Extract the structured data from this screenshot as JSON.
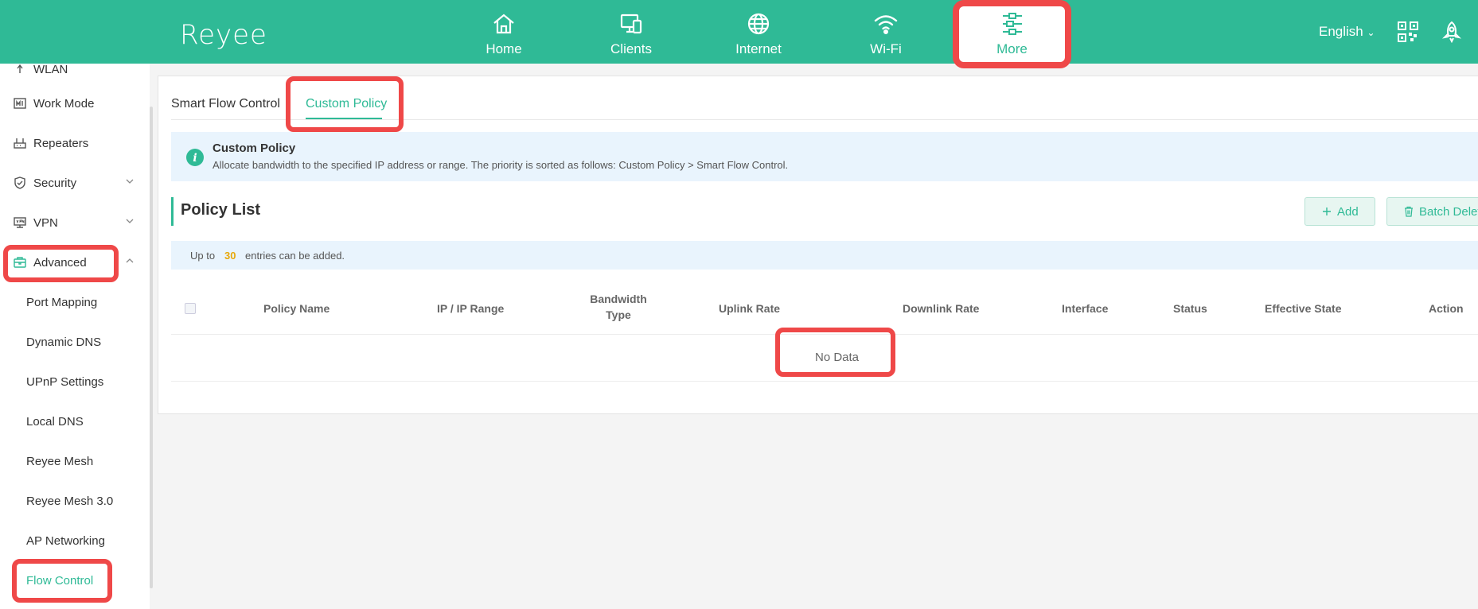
{
  "header": {
    "logo": "Reyee",
    "nav": [
      {
        "label": "Home",
        "icon": "home-icon"
      },
      {
        "label": "Clients",
        "icon": "devices-icon"
      },
      {
        "label": "Internet",
        "icon": "globe-icon"
      },
      {
        "label": "Wi-Fi",
        "icon": "wifi-icon"
      },
      {
        "label": "More",
        "icon": "sliders-icon",
        "active": true
      }
    ],
    "language": "English",
    "icons": [
      "qr-code-icon",
      "rocket-icon"
    ]
  },
  "sidebar": {
    "items": [
      {
        "label": "WLAN",
        "icon": "wlan-icon"
      },
      {
        "label": "Work Mode",
        "icon": "work-mode-icon"
      },
      {
        "label": "Repeaters",
        "icon": "router-icon"
      },
      {
        "label": "Security",
        "icon": "shield-icon",
        "expandable": true
      },
      {
        "label": "VPN",
        "icon": "vpn-icon",
        "expandable": true
      },
      {
        "label": "Advanced",
        "icon": "toolbox-icon",
        "expanded": true
      }
    ],
    "subitems": [
      "Port Mapping",
      "Dynamic DNS",
      "UPnP Settings",
      "Local DNS",
      "Reyee Mesh",
      "Reyee Mesh 3.0",
      "AP Networking",
      "Flow Control"
    ],
    "active_subitem": "Flow Control"
  },
  "main": {
    "tabs": [
      {
        "label": "Smart Flow Control"
      },
      {
        "label": "Custom Policy",
        "active": true
      }
    ],
    "info": {
      "title": "Custom Policy",
      "description": "Allocate bandwidth to the specified IP address or range. The priority is sorted as follows: Custom Policy > Smart Flow Control."
    },
    "policy_list": {
      "title": "Policy List",
      "add_label": "Add",
      "batch_delete_label": "Batch Delet",
      "limit_prefix": "Up to",
      "limit_count": "30",
      "limit_suffix": "entries can be added.",
      "columns": [
        "Policy Name",
        "IP / IP Range",
        "Bandwidth Type",
        "Uplink Rate",
        "Downlink Rate",
        "Interface",
        "Status",
        "Effective State",
        "Action"
      ],
      "column_bandwidth_line1": "Bandwidth",
      "column_bandwidth_line2": "Type",
      "empty_text": "No Data"
    }
  },
  "colors": {
    "brand": "#2fba96",
    "highlight": "#ef4848",
    "info_bg": "#e9f4fd",
    "count": "#e7a80c"
  }
}
